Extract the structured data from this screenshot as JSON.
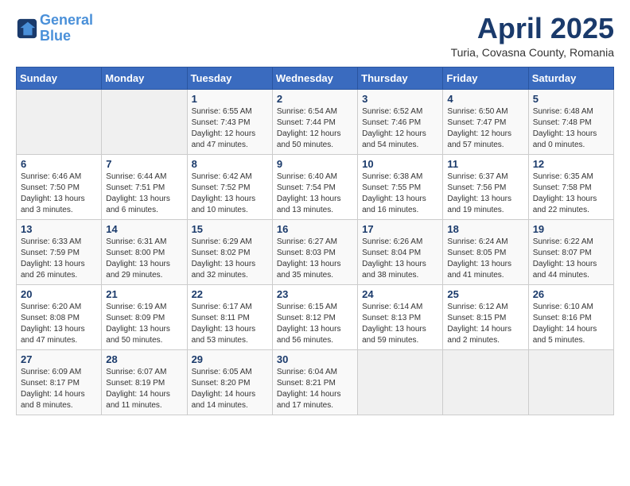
{
  "header": {
    "logo_line1": "General",
    "logo_line2": "Blue",
    "title": "April 2025",
    "subtitle": "Turia, Covasna County, Romania"
  },
  "weekdays": [
    "Sunday",
    "Monday",
    "Tuesday",
    "Wednesday",
    "Thursday",
    "Friday",
    "Saturday"
  ],
  "weeks": [
    [
      {
        "day": "",
        "info": ""
      },
      {
        "day": "",
        "info": ""
      },
      {
        "day": "1",
        "info": "Sunrise: 6:55 AM\nSunset: 7:43 PM\nDaylight: 12 hours and 47 minutes."
      },
      {
        "day": "2",
        "info": "Sunrise: 6:54 AM\nSunset: 7:44 PM\nDaylight: 12 hours and 50 minutes."
      },
      {
        "day": "3",
        "info": "Sunrise: 6:52 AM\nSunset: 7:46 PM\nDaylight: 12 hours and 54 minutes."
      },
      {
        "day": "4",
        "info": "Sunrise: 6:50 AM\nSunset: 7:47 PM\nDaylight: 12 hours and 57 minutes."
      },
      {
        "day": "5",
        "info": "Sunrise: 6:48 AM\nSunset: 7:48 PM\nDaylight: 13 hours and 0 minutes."
      }
    ],
    [
      {
        "day": "6",
        "info": "Sunrise: 6:46 AM\nSunset: 7:50 PM\nDaylight: 13 hours and 3 minutes."
      },
      {
        "day": "7",
        "info": "Sunrise: 6:44 AM\nSunset: 7:51 PM\nDaylight: 13 hours and 6 minutes."
      },
      {
        "day": "8",
        "info": "Sunrise: 6:42 AM\nSunset: 7:52 PM\nDaylight: 13 hours and 10 minutes."
      },
      {
        "day": "9",
        "info": "Sunrise: 6:40 AM\nSunset: 7:54 PM\nDaylight: 13 hours and 13 minutes."
      },
      {
        "day": "10",
        "info": "Sunrise: 6:38 AM\nSunset: 7:55 PM\nDaylight: 13 hours and 16 minutes."
      },
      {
        "day": "11",
        "info": "Sunrise: 6:37 AM\nSunset: 7:56 PM\nDaylight: 13 hours and 19 minutes."
      },
      {
        "day": "12",
        "info": "Sunrise: 6:35 AM\nSunset: 7:58 PM\nDaylight: 13 hours and 22 minutes."
      }
    ],
    [
      {
        "day": "13",
        "info": "Sunrise: 6:33 AM\nSunset: 7:59 PM\nDaylight: 13 hours and 26 minutes."
      },
      {
        "day": "14",
        "info": "Sunrise: 6:31 AM\nSunset: 8:00 PM\nDaylight: 13 hours and 29 minutes."
      },
      {
        "day": "15",
        "info": "Sunrise: 6:29 AM\nSunset: 8:02 PM\nDaylight: 13 hours and 32 minutes."
      },
      {
        "day": "16",
        "info": "Sunrise: 6:27 AM\nSunset: 8:03 PM\nDaylight: 13 hours and 35 minutes."
      },
      {
        "day": "17",
        "info": "Sunrise: 6:26 AM\nSunset: 8:04 PM\nDaylight: 13 hours and 38 minutes."
      },
      {
        "day": "18",
        "info": "Sunrise: 6:24 AM\nSunset: 8:05 PM\nDaylight: 13 hours and 41 minutes."
      },
      {
        "day": "19",
        "info": "Sunrise: 6:22 AM\nSunset: 8:07 PM\nDaylight: 13 hours and 44 minutes."
      }
    ],
    [
      {
        "day": "20",
        "info": "Sunrise: 6:20 AM\nSunset: 8:08 PM\nDaylight: 13 hours and 47 minutes."
      },
      {
        "day": "21",
        "info": "Sunrise: 6:19 AM\nSunset: 8:09 PM\nDaylight: 13 hours and 50 minutes."
      },
      {
        "day": "22",
        "info": "Sunrise: 6:17 AM\nSunset: 8:11 PM\nDaylight: 13 hours and 53 minutes."
      },
      {
        "day": "23",
        "info": "Sunrise: 6:15 AM\nSunset: 8:12 PM\nDaylight: 13 hours and 56 minutes."
      },
      {
        "day": "24",
        "info": "Sunrise: 6:14 AM\nSunset: 8:13 PM\nDaylight: 13 hours and 59 minutes."
      },
      {
        "day": "25",
        "info": "Sunrise: 6:12 AM\nSunset: 8:15 PM\nDaylight: 14 hours and 2 minutes."
      },
      {
        "day": "26",
        "info": "Sunrise: 6:10 AM\nSunset: 8:16 PM\nDaylight: 14 hours and 5 minutes."
      }
    ],
    [
      {
        "day": "27",
        "info": "Sunrise: 6:09 AM\nSunset: 8:17 PM\nDaylight: 14 hours and 8 minutes."
      },
      {
        "day": "28",
        "info": "Sunrise: 6:07 AM\nSunset: 8:19 PM\nDaylight: 14 hours and 11 minutes."
      },
      {
        "day": "29",
        "info": "Sunrise: 6:05 AM\nSunset: 8:20 PM\nDaylight: 14 hours and 14 minutes."
      },
      {
        "day": "30",
        "info": "Sunrise: 6:04 AM\nSunset: 8:21 PM\nDaylight: 14 hours and 17 minutes."
      },
      {
        "day": "",
        "info": ""
      },
      {
        "day": "",
        "info": ""
      },
      {
        "day": "",
        "info": ""
      }
    ]
  ]
}
